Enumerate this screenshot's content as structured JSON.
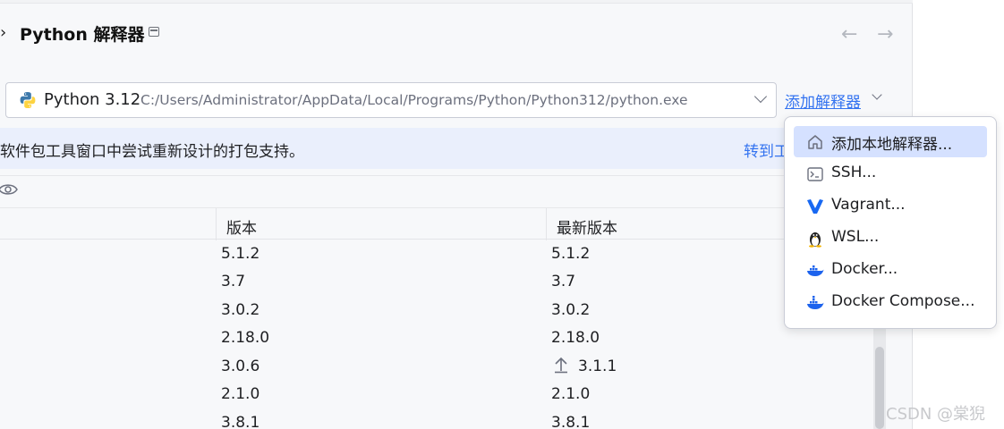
{
  "header": {
    "title": "Python 解释器",
    "expand_glyph": "›",
    "back_glyph": "←",
    "forward_glyph": "→"
  },
  "interpreter": {
    "name": "Python 3.12",
    "path": "C:/Users/Administrator/AppData/Local/Programs/Python/Python312/python.exe",
    "icon": "python-logo-icon"
  },
  "add_interpreter": {
    "label": "添加解释器"
  },
  "banner": {
    "text": "软件包工具窗口中尝试重新设计的打包支持。",
    "link": "转到工"
  },
  "table": {
    "columns": [
      "",
      "版本",
      "最新版本"
    ],
    "rows": [
      {
        "version": "5.1.2",
        "latest": "5.1.2",
        "upgrade": false
      },
      {
        "version": "3.7",
        "latest": "3.7",
        "upgrade": false
      },
      {
        "version": "3.0.2",
        "latest": "3.0.2",
        "upgrade": false
      },
      {
        "version": "2.18.0",
        "latest": "2.18.0",
        "upgrade": false
      },
      {
        "version": "3.0.6",
        "latest": "3.1.1",
        "upgrade": true
      },
      {
        "version": "2.1.0",
        "latest": "2.1.0",
        "upgrade": false
      },
      {
        "version": "3.8.1",
        "latest": "3.8.1",
        "upgrade": false
      }
    ]
  },
  "menu": {
    "items": [
      {
        "label": "添加本地解释器...",
        "icon": "home-icon",
        "selected": true
      },
      {
        "label": "SSH...",
        "icon": "terminal-icon",
        "selected": false
      },
      {
        "label": "Vagrant...",
        "icon": "vagrant-icon",
        "selected": false
      },
      {
        "label": "WSL...",
        "icon": "linux-penguin-icon",
        "selected": false
      },
      {
        "label": "Docker...",
        "icon": "docker-icon",
        "selected": false
      },
      {
        "label": "Docker Compose...",
        "icon": "docker-compose-icon",
        "selected": false
      }
    ]
  },
  "colors": {
    "link": "#3574f0",
    "selected_menu": "#d5e1ff",
    "banner_bg": "#eaeffc",
    "panel_bg": "#f7f8fa"
  },
  "watermark": "CSDN @棠猊"
}
